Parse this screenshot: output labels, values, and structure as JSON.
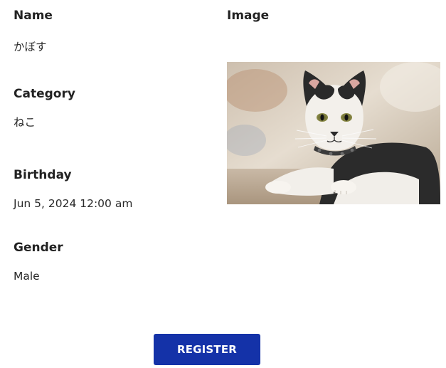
{
  "fields": {
    "name": {
      "label": "Name",
      "value": "かぼす"
    },
    "category": {
      "label": "Category",
      "value": "ねこ"
    },
    "birthday": {
      "label": "Birthday",
      "value": "Jun 5, 2024 12:00 am"
    },
    "gender": {
      "label": "Gender",
      "value": "Male"
    },
    "image": {
      "label": "Image"
    }
  },
  "actions": {
    "register_label": "REGISTER"
  },
  "colors": {
    "button_background": "#1432a8",
    "button_text": "#ffffff",
    "label_text": "#222222"
  }
}
